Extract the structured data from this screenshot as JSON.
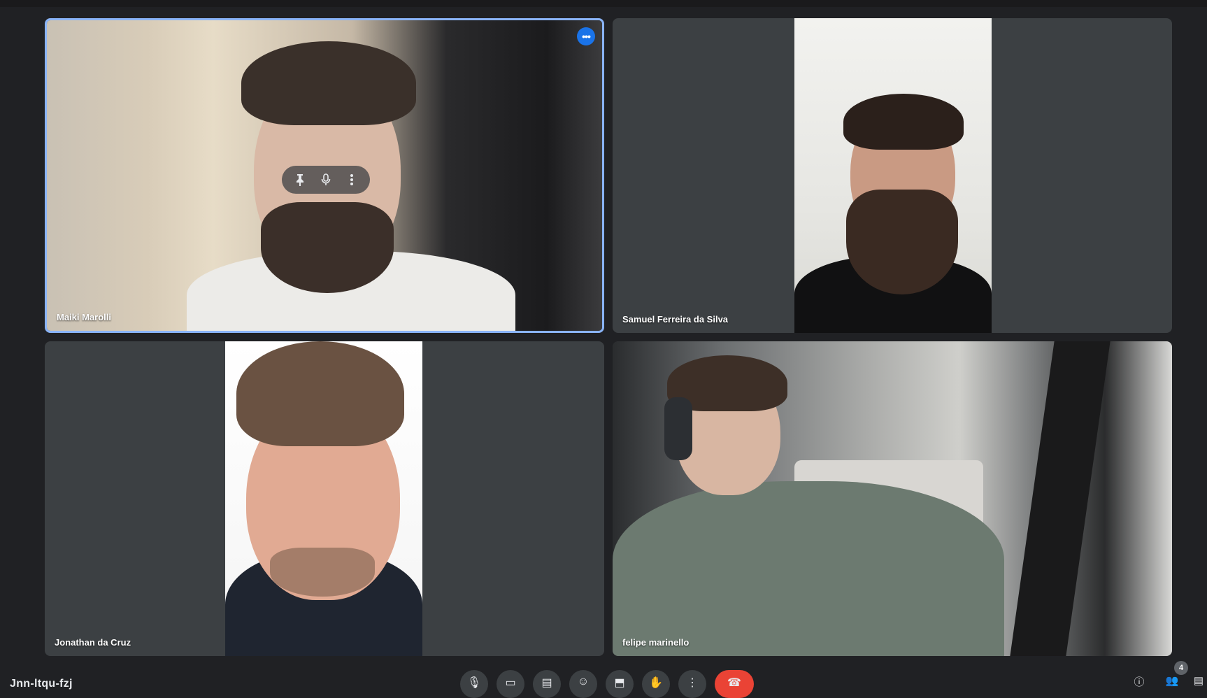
{
  "participants": [
    {
      "name": "Maiki Marolli",
      "active_speaker": true
    },
    {
      "name": "Samuel Ferreira da Silva",
      "active_speaker": false
    },
    {
      "name": "Jonathan da Cruz",
      "active_speaker": false
    },
    {
      "name": "felipe marinello",
      "active_speaker": false
    }
  ],
  "tile_menu": {
    "more_options_glyph": "•••"
  },
  "hover_controls": {
    "pin_icon": "pin-icon",
    "mic_icon": "mic-icon",
    "more_icon": "more-vert-icon"
  },
  "bottom_bar": {
    "meeting_code": "Jnn-ltqu-fzj",
    "controls": [
      {
        "icon": "mic-icon",
        "glyph": "🎙"
      },
      {
        "icon": "camera-icon",
        "glyph": "▭"
      },
      {
        "icon": "captions-icon",
        "glyph": "▤"
      },
      {
        "icon": "emoji-icon",
        "glyph": "☺"
      },
      {
        "icon": "present-icon",
        "glyph": "⬒"
      },
      {
        "icon": "raise-hand-icon",
        "glyph": "✋"
      },
      {
        "icon": "more-options-icon",
        "glyph": "⋮"
      },
      {
        "icon": "end-call-icon",
        "glyph": "☎"
      }
    ],
    "right": {
      "info_icon": "ⓘ",
      "people_count": "4",
      "people_icon": "👥",
      "chat_icon": "▤"
    }
  },
  "colors": {
    "background": "#202124",
    "tile": "#3c4043",
    "active_border": "#8ab4f8",
    "end_call": "#ea4335",
    "accent": "#1a73e8"
  }
}
